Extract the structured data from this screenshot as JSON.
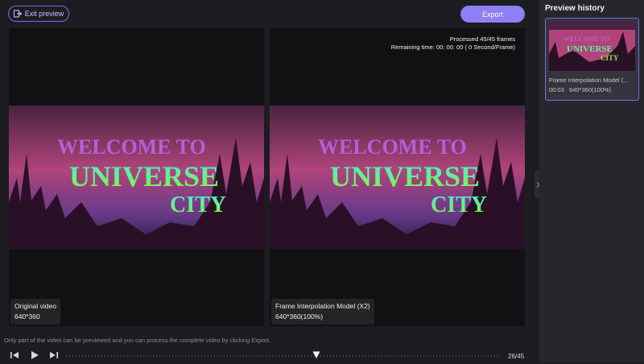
{
  "header": {
    "exit_label": "Exit preview",
    "export_label": "Export"
  },
  "original_panel": {
    "caption_title": "Original video",
    "caption_resolution": "640*360"
  },
  "processed_panel": {
    "caption_title": "Frame Interpolation Model (X2)",
    "caption_resolution": "640*360(100%)",
    "processed_text": "Processed 45/45 frames",
    "remaining_text": "Remaining time: 00: 00: 00 ( 0 Second/Frame)"
  },
  "video_title": {
    "line1": "WELCOME TO",
    "line2": "UNIVERSE",
    "line3": "CITY"
  },
  "notice": "Only part of the video can be previewed and you can process the complete video by clicking Export.",
  "playback": {
    "frame_counter": "26/45",
    "position_fraction": 0.578
  },
  "sidebar": {
    "title": "Preview history",
    "items": [
      {
        "name": "Frame Interpolation Model (...",
        "duration": "00:03",
        "resolution": "640*360(100%)"
      }
    ]
  },
  "colors": {
    "accent": "#8d7ff5",
    "accent_border": "#7b6cf0"
  }
}
